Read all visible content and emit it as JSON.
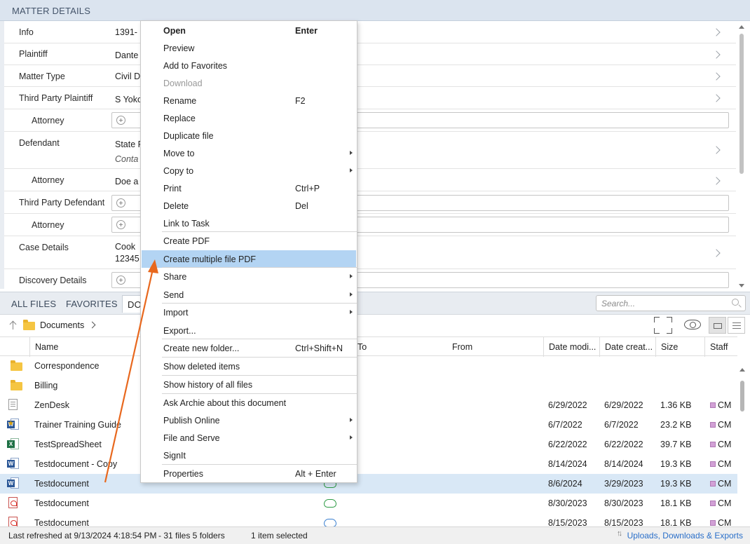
{
  "matter_details": {
    "title": "MATTER DETAILS",
    "rows": [
      {
        "label": "Info",
        "value": "1391-"
      },
      {
        "label": "Plaintiff",
        "value": "Dante"
      },
      {
        "label": "Matter Type",
        "value": "Civil D"
      },
      {
        "label": "Third Party Plaintiff",
        "value": "S Yoko"
      },
      {
        "label": "Attorney",
        "value": ""
      },
      {
        "label": "Defendant",
        "value": "State F",
        "value2": "Conta"
      },
      {
        "label": "Attorney",
        "value": "Doe a"
      },
      {
        "label": "Third Party Defendant",
        "value": ""
      },
      {
        "label": "Attorney",
        "value": ""
      },
      {
        "label": "Case Details",
        "value": "Cook",
        "value2": "12345"
      },
      {
        "label": "Discovery Details",
        "value": ""
      }
    ]
  },
  "tabs": [
    {
      "label": "ALL FILES",
      "active": false
    },
    {
      "label": "FAVORITES",
      "active": false
    },
    {
      "label": "DO",
      "active": true
    }
  ],
  "search": {
    "placeholder": "Search..."
  },
  "breadcrumb": {
    "folder": "Documents"
  },
  "grid": {
    "columns": [
      "Name",
      "To",
      "From",
      "Date modi...",
      "Date creat...",
      "Size",
      "Staff"
    ],
    "rows": [
      {
        "icon": "folder-icon",
        "name": "Correspondence",
        "modified": "",
        "created": "",
        "size": "",
        "staff": "",
        "sync": ""
      },
      {
        "icon": "folder-icon",
        "name": "Billing",
        "modified": "",
        "created": "",
        "size": "",
        "staff": "",
        "sync": ""
      },
      {
        "icon": "text-file-icon",
        "name": "ZenDesk",
        "modified": "6/29/2022",
        "created": "6/29/2022",
        "size": "1.36 KB",
        "staff": "CM",
        "sync": ""
      },
      {
        "icon": "word-icon",
        "name": "Trainer Training Guide",
        "modified": "6/7/2022",
        "created": "6/7/2022",
        "size": "23.2 KB",
        "staff": "CM",
        "sync": ""
      },
      {
        "icon": "excel-icon",
        "name": "TestSpreadSheet",
        "modified": "6/22/2022",
        "created": "6/22/2022",
        "size": "39.7 KB",
        "staff": "CM",
        "sync": ""
      },
      {
        "icon": "word-icon",
        "name": "Testdocument - Copy",
        "modified": "8/14/2024",
        "created": "8/14/2024",
        "size": "19.3 KB",
        "staff": "CM",
        "sync": ""
      },
      {
        "icon": "word-icon",
        "name": "Testdocument",
        "modified": "8/6/2024",
        "created": "3/29/2023",
        "size": "19.3 KB",
        "staff": "CM",
        "sync": "green",
        "selected": true
      },
      {
        "icon": "pdf-icon",
        "name": "Testdocument",
        "modified": "8/30/2023",
        "created": "8/30/2023",
        "size": "18.1 KB",
        "staff": "CM",
        "sync": "green"
      },
      {
        "icon": "pdf-icon",
        "name": "Testdocument",
        "modified": "8/15/2023",
        "created": "8/15/2023",
        "size": "18.1 KB",
        "staff": "CM",
        "sync": "blue"
      }
    ]
  },
  "status": {
    "refreshed": "Last refreshed at 9/13/2024 4:18:54 PM",
    "counts": "-  31 files  5 folders",
    "selection": "1 item selected",
    "link": "Uploads, Downloads & Exports"
  },
  "context_menu": {
    "items": [
      {
        "label": "Open",
        "shortcut": "Enter",
        "bold": true
      },
      {
        "label": "Preview"
      },
      {
        "label": "Add to Favorites"
      },
      {
        "label": "Download",
        "disabled": true
      },
      {
        "label": "Rename",
        "shortcut": "F2"
      },
      {
        "label": "Replace"
      },
      {
        "label": "Duplicate file"
      },
      {
        "label": "Move to",
        "submenu": true
      },
      {
        "label": "Copy to",
        "submenu": true
      },
      {
        "label": "Print",
        "shortcut": "Ctrl+P"
      },
      {
        "label": "Delete",
        "shortcut": "Del"
      },
      {
        "label": "Link to Task",
        "separator_after": true
      },
      {
        "label": "Create PDF"
      },
      {
        "label": "Create multiple file PDF",
        "highlighted": true,
        "separator_after": true
      },
      {
        "label": "Share",
        "submenu": true
      },
      {
        "label": "Send",
        "submenu": true,
        "separator_after": true
      },
      {
        "label": "Import",
        "submenu": true
      },
      {
        "label": "Export...",
        "separator_after": true
      },
      {
        "label": "Create new folder...",
        "shortcut": "Ctrl+Shift+N",
        "separator_after": true
      },
      {
        "label": "Show deleted items",
        "separator_after": true
      },
      {
        "label": "Show history of all files",
        "separator_after": true
      },
      {
        "label": "Ask Archie about this document"
      },
      {
        "label": "Publish Online",
        "submenu": true
      },
      {
        "label": "File and Serve",
        "submenu": true
      },
      {
        "label": "SignIt",
        "separator_after": true
      },
      {
        "label": "Properties",
        "shortcut": "Alt + Enter"
      }
    ]
  },
  "colors": {
    "highlight": "#b3d4f3",
    "selected_row": "#d9e8f6",
    "annotation_arrow": "#e8681e",
    "link": "#2a6fc9"
  }
}
